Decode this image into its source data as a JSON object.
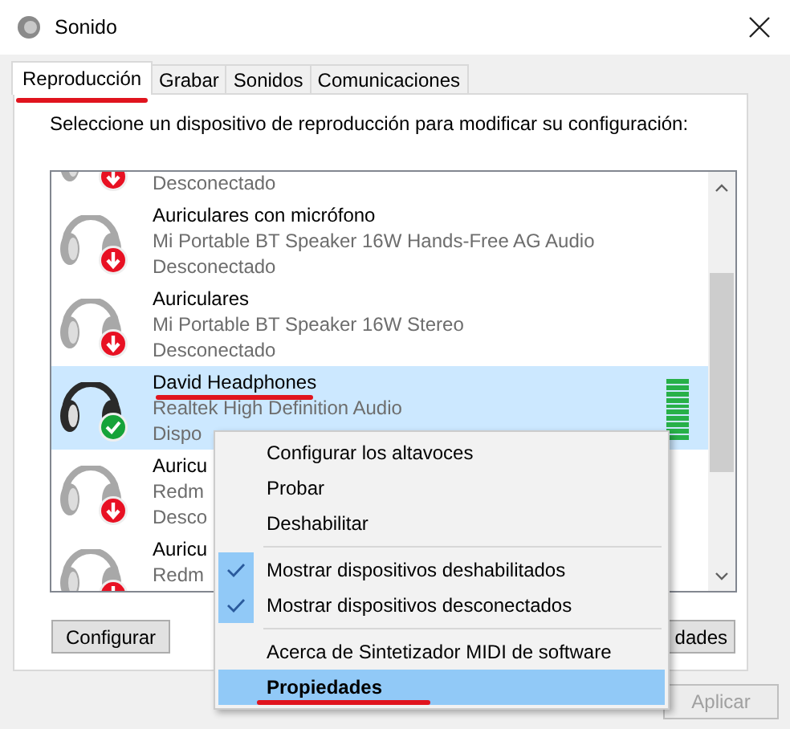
{
  "window": {
    "title": "Sonido"
  },
  "tabs": [
    {
      "label": "Reproducción",
      "selected": true,
      "underlined": true
    },
    {
      "label": "Grabar",
      "selected": false,
      "underlined": false
    },
    {
      "label": "Sonidos",
      "selected": false,
      "underlined": false
    },
    {
      "label": "Comunicaciones",
      "selected": false,
      "underlined": false
    }
  ],
  "instruction": "Seleccione un dispositivo de reproducción para modificar su configuración:",
  "devices": [
    {
      "status_text": "Desconectado",
      "default_device": false,
      "selected": false,
      "underlined": false
    },
    {
      "name": "Auriculares con micrófono",
      "description": "Mi Portable BT Speaker 16W Hands-Free AG Audio",
      "status_text": "Desconectado",
      "default_device": false,
      "selected": false,
      "underlined": false
    },
    {
      "name": "Auriculares",
      "description": "Mi Portable BT Speaker 16W Stereo",
      "status_text": "Desconectado",
      "default_device": false,
      "selected": false,
      "underlined": false
    },
    {
      "name": "David Headphones",
      "description": "Realtek High Definition Audio",
      "status_text": "Dispo",
      "default_device": true,
      "selected": true,
      "underlined": true,
      "level": 1
    },
    {
      "name": "Auricu",
      "description": "Redm",
      "status_text": "Desco",
      "default_device": false,
      "selected": false,
      "underlined": false
    },
    {
      "name": "Auricu",
      "description": "Redm",
      "default_device": false,
      "selected": false,
      "underlined": false
    }
  ],
  "panel_buttons": [
    {
      "label": "Configurar"
    },
    {
      "label": "dades"
    }
  ],
  "dialog_buttons": [
    {
      "label": "Aplicar",
      "disabled": true
    }
  ],
  "context_menu": [
    {
      "kind": "item",
      "label": "Configurar los altavoces",
      "checked": false,
      "selected": false,
      "bold": false,
      "underlined": false
    },
    {
      "kind": "item",
      "label": "Probar",
      "checked": false,
      "selected": false,
      "bold": false,
      "underlined": false
    },
    {
      "kind": "item",
      "label": "Deshabilitar",
      "checked": false,
      "selected": false,
      "bold": false,
      "underlined": false
    },
    {
      "kind": "separator"
    },
    {
      "kind": "item",
      "label": "Mostrar dispositivos deshabilitados",
      "checked": true,
      "selected": false,
      "bold": false,
      "underlined": false
    },
    {
      "kind": "item",
      "label": "Mostrar dispositivos desconectados",
      "checked": true,
      "selected": false,
      "bold": false,
      "underlined": false
    },
    {
      "kind": "separator"
    },
    {
      "kind": "item",
      "label": "Acerca de Sintetizador MIDI de software",
      "checked": false,
      "selected": false,
      "bold": false,
      "underlined": false
    },
    {
      "kind": "item",
      "label": "Propiedades",
      "checked": false,
      "selected": true,
      "bold": true,
      "underlined": true
    }
  ]
}
